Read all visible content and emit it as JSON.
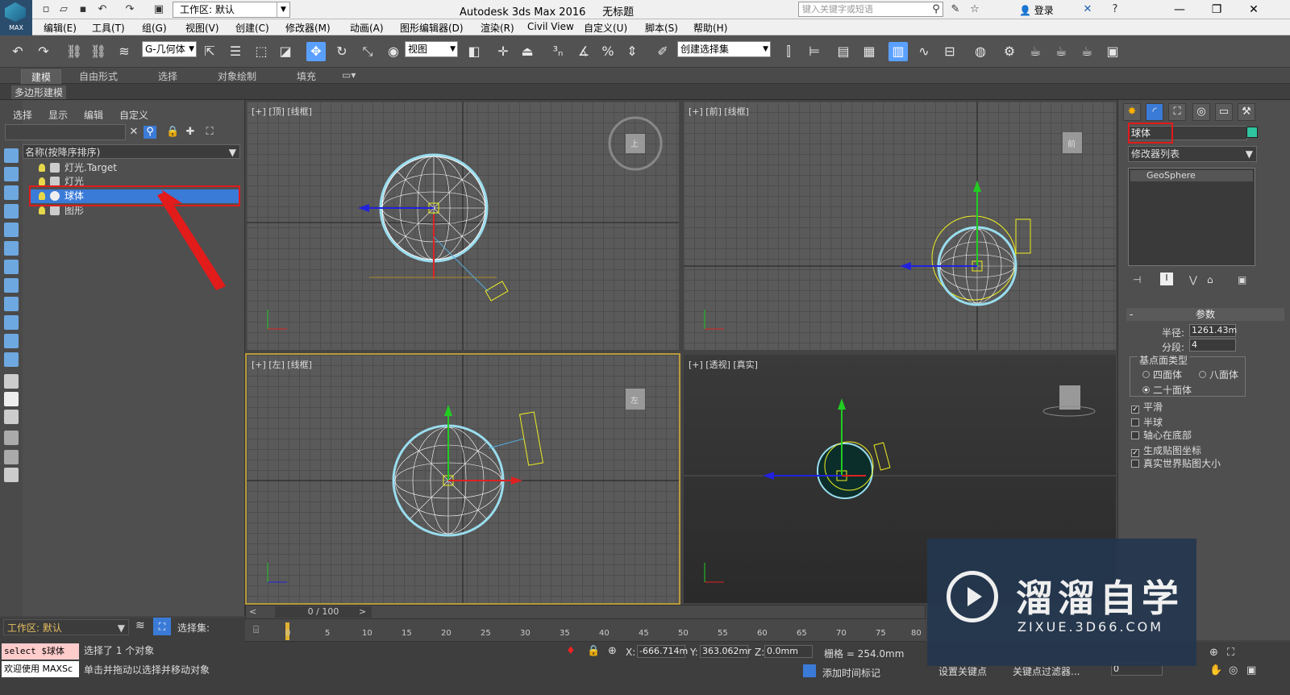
{
  "app": {
    "logo_label": "MAX",
    "title": "Autodesk 3ds Max 2016",
    "doc_title": "无标题",
    "workspace": "工作区: 默认",
    "search_placeholder": "键入关键字或短语",
    "login": "登录"
  },
  "menu": [
    "编辑(E)",
    "工具(T)",
    "组(G)",
    "视图(V)",
    "创建(C)",
    "修改器(M)",
    "动画(A)",
    "图形编辑器(D)",
    "渲染(R)",
    "Civil View",
    "自定义(U)",
    "脚本(S)",
    "帮助(H)"
  ],
  "toolbar": {
    "selection_filter": "G-几何体",
    "ref_coord": "视图",
    "named_selection": "创建选择集"
  },
  "ribbon": {
    "tabs": [
      "建模",
      "自由形式",
      "选择",
      "对象绘制",
      "填充"
    ],
    "sub": "多边形建模"
  },
  "scene_explorer": {
    "menu": [
      "选择",
      "显示",
      "编辑",
      "自定义"
    ],
    "column_header": "名称(按降序排序)",
    "items": [
      {
        "name": "灯光.Target",
        "icon": "light-target-icon"
      },
      {
        "name": "灯光",
        "icon": "light-icon"
      },
      {
        "name": "球体",
        "icon": "sphere-icon",
        "selected": true
      },
      {
        "name": "图形",
        "icon": "shape-icon"
      }
    ],
    "workspace": "工作区: 默认",
    "selection_set_label": "选择集:"
  },
  "viewports": [
    {
      "label": "[+] [顶] [线框]",
      "cube": "上"
    },
    {
      "label": "[+] [前] [线框]",
      "cube": "前"
    },
    {
      "label": "[+] [左] [线框]",
      "cube": "左"
    },
    {
      "label": "[+] [透视] [真实]",
      "cube": ""
    }
  ],
  "command_panel": {
    "object_name": "球体",
    "modifier_list": "修改器列表",
    "stack_item": "GeoSphere",
    "params_title": "参数",
    "radius_label": "半径:",
    "radius_value": "1261.43m",
    "segments_label": "分段:",
    "segments_value": "4",
    "base_type_label": "基点面类型",
    "types": [
      {
        "label": "四面体",
        "on": false
      },
      {
        "label": "八面体",
        "on": false
      },
      {
        "label": "二十面体",
        "on": true
      }
    ],
    "checks": [
      {
        "label": "平滑",
        "on": true
      },
      {
        "label": "半球",
        "on": false
      },
      {
        "label": "轴心在底部",
        "on": false
      },
      {
        "label": "生成贴图坐标",
        "on": true
      },
      {
        "label": "真实世界贴图大小",
        "on": false
      }
    ],
    "accent": "#2ec5a0"
  },
  "timeline": {
    "frame": "0 / 100",
    "ticks": [
      "0",
      "5",
      "10",
      "15",
      "20",
      "25",
      "30",
      "35",
      "40",
      "45",
      "50",
      "55",
      "60",
      "65",
      "70",
      "75",
      "80"
    ]
  },
  "status": {
    "script_line1": "select $球体",
    "script_line2": "欢迎使用 MAXSc",
    "selection_msg": "选择了 1 个对象",
    "prompt_msg": "单击并拖动以选择并移动对象",
    "x_label": "X:",
    "x_value": "-666.714m",
    "y_label": "Y:",
    "y_value": "363.062mr",
    "z_label": "Z:",
    "z_value": "0.0mm",
    "grid": "栅格 = 254.0mm",
    "add_time_tag": "添加时间标记",
    "set_key": "设置关键点",
    "key_filter": "关键点过滤器...",
    "frame_value": "0"
  },
  "watermark": {
    "title": "溜溜自学",
    "url": "ZIXUE.3D66.COM"
  }
}
